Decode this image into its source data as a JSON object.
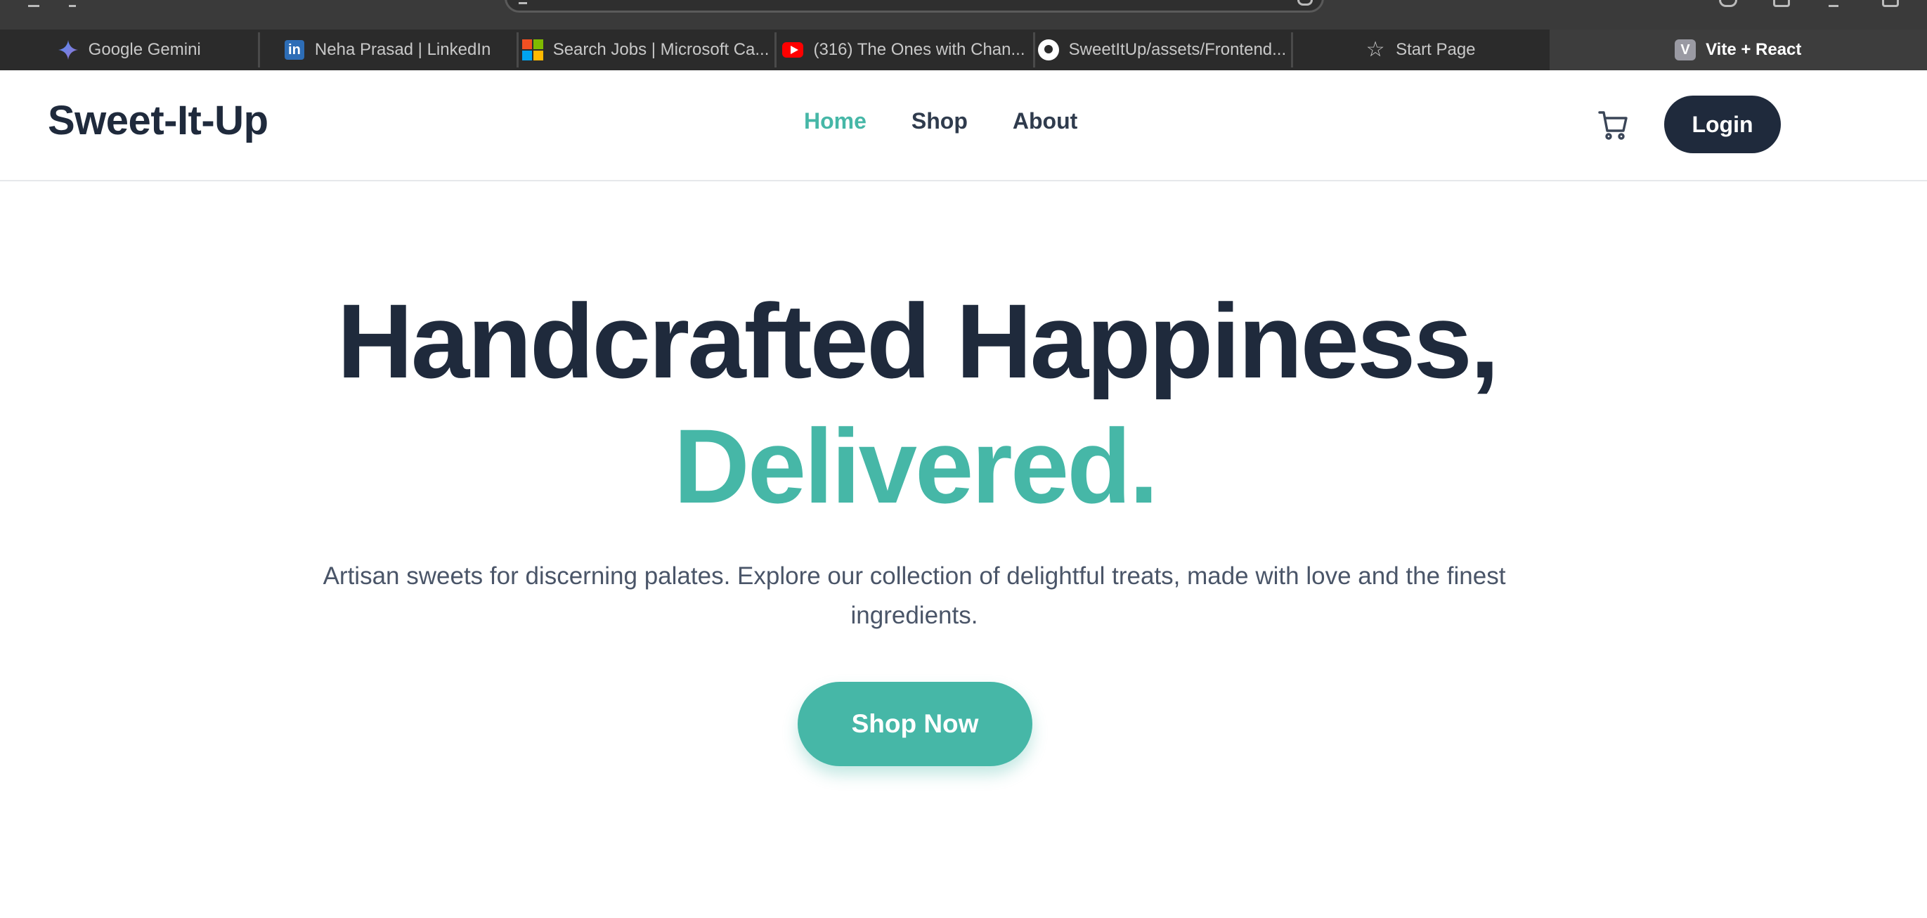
{
  "browser": {
    "tabs": [
      {
        "label": "Google Gemini",
        "icon": "gemini-icon"
      },
      {
        "label": "Neha Prasad | LinkedIn",
        "icon": "linkedin-icon"
      },
      {
        "label": "Search Jobs | Microsoft Ca...",
        "icon": "microsoft-icon"
      },
      {
        "label": "(316) The Ones with Chan...",
        "icon": "youtube-icon"
      },
      {
        "label": "SweetItUp/assets/Frontend...",
        "icon": "github-icon"
      },
      {
        "label": "Start Page",
        "icon": "star-icon"
      },
      {
        "label": "Vite + React",
        "icon": "vite-icon",
        "icon_text": "V",
        "active": true
      }
    ],
    "linkedin_icon_text": "in"
  },
  "site": {
    "brand": "Sweet-It-Up",
    "nav": [
      {
        "label": "Home",
        "active": true
      },
      {
        "label": "Shop",
        "active": false
      },
      {
        "label": "About",
        "active": false
      }
    ],
    "cart_icon": "cart-icon",
    "login_label": "Login"
  },
  "hero": {
    "title_line1": "Handcrafted Happiness,",
    "title_line2": "Delivered.",
    "subtitle": "Artisan sweets for discerning palates. Explore our collection of delightful treats, made with love and the finest ingredients.",
    "cta_label": "Shop Now"
  },
  "colors": {
    "brand_dark": "#1f2a3c",
    "accent_teal": "#46b7a7",
    "body_text": "#4a5568",
    "tab_bar": "#2b2b2b"
  }
}
